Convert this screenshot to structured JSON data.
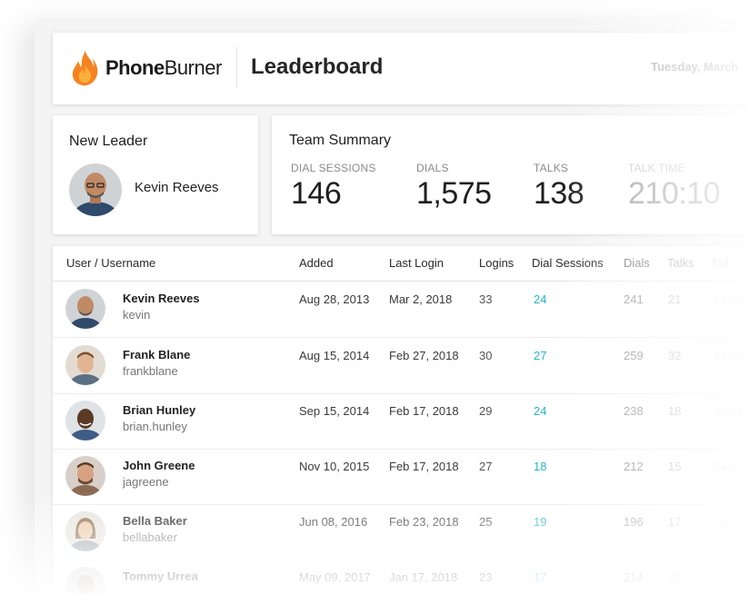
{
  "header": {
    "logo_bold": "Phone",
    "logo_regular": "Burner",
    "title": "Leaderboard",
    "date": "Tuesday, March"
  },
  "new_leader": {
    "title": "New Leader",
    "name": "Kevin Reeves"
  },
  "team_summary": {
    "title": "Team Summary",
    "stats": [
      {
        "label": "DIAL SESSIONS",
        "value": "146"
      },
      {
        "label": "DIALS",
        "value": "1,575"
      },
      {
        "label": "TALKS",
        "value": "138"
      },
      {
        "label": "TALK TIME",
        "value": "210:10"
      }
    ]
  },
  "table": {
    "columns": [
      "User / Username",
      "Added",
      "Last Login",
      "Logins",
      "Dial Sessions",
      "Dials",
      "Talks",
      "Talk"
    ],
    "rows": [
      {
        "name": "Kevin Reeves",
        "username": "kevin",
        "added": "Aug 28, 2013",
        "last_login": "Mar 2, 2018",
        "logins": "33",
        "dial_sessions": "24",
        "dials": "241",
        "talks": "21",
        "talk_time": "19:32"
      },
      {
        "name": "Frank Blane",
        "username": "frankblane",
        "added": "Aug 15, 2014",
        "last_login": "Feb 27, 2018",
        "logins": "30",
        "dial_sessions": "27",
        "dials": "259",
        "talks": "32",
        "talk_time": "43:45"
      },
      {
        "name": "Brian Hunley",
        "username": "brian.hunley",
        "added": "Sep 15, 2014",
        "last_login": "Feb 17, 2018",
        "logins": "29",
        "dial_sessions": "24",
        "dials": "238",
        "talks": "18",
        "talk_time": "38:04"
      },
      {
        "name": "John Greene",
        "username": "jagreene",
        "added": "Nov 10, 2015",
        "last_login": "Feb 17, 2018",
        "logins": "27",
        "dial_sessions": "18",
        "dials": "212",
        "talks": "15",
        "talk_time": "24:03"
      },
      {
        "name": "Bella Baker",
        "username": "bellabaker",
        "added": "Jun 08, 2016",
        "last_login": "Feb 23, 2018",
        "logins": "25",
        "dial_sessions": "19",
        "dials": "196",
        "talks": "17",
        "talk_time": "29:22"
      },
      {
        "name": "Tommy Urrea",
        "username": "",
        "added": "May 09, 2017",
        "last_login": "Jan 17, 2018",
        "logins": "23",
        "dial_sessions": "17",
        "dials": "214",
        "talks": "19",
        "talk_time": "23:1"
      }
    ]
  },
  "colors": {
    "accent_link": "#25b3d1",
    "flame_orange": "#f58220",
    "flame_yellow": "#fbb03b"
  },
  "icons": {
    "logo": "flame-icon",
    "avatar": "user-photo"
  }
}
